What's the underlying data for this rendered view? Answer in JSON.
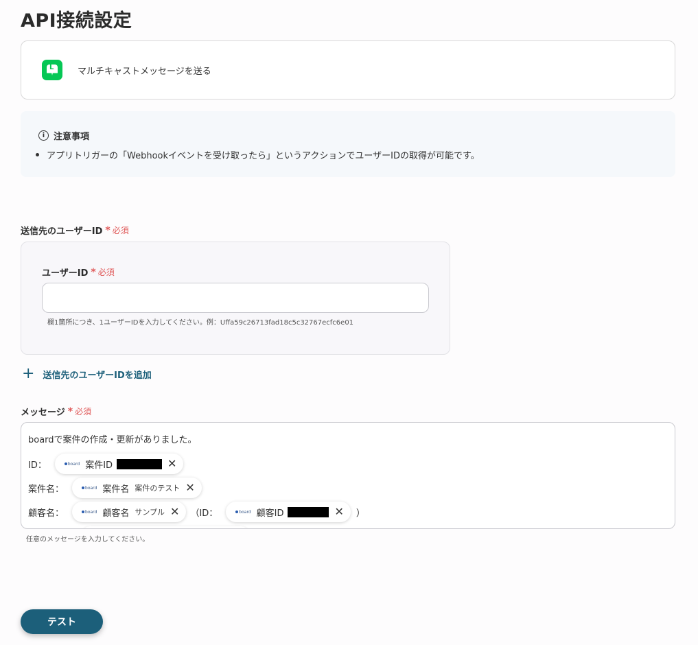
{
  "page": {
    "title": "API接続設定"
  },
  "action": {
    "label": "マルチキャストメッセージを送る",
    "icon": "line-icon",
    "brand_color": "#06c755"
  },
  "notice": {
    "title": "注意事項",
    "items": [
      "アプリトリガーの「Webhookイベントを受け取ったら」というアクションでユーザーIDの取得が可能です。"
    ]
  },
  "recipients": {
    "label": "送信先のユーザーID",
    "required_label": "必須",
    "user_id": {
      "label": "ユーザーID",
      "required_label": "必須",
      "value": "",
      "hint": "欄1箇所につき、1ユーザーIDを入力してください。例：Uffa59c26713fad18c5c32767ecfc6e01"
    },
    "add_label": "送信先のユーザーIDを追加"
  },
  "message": {
    "label": "メッセージ",
    "required_label": "必須",
    "first_line": "boardで案件の作成・更新がありました。",
    "lines": [
      {
        "prefix": "ID：",
        "chip_name": "案件ID",
        "chip_value": ""
      },
      {
        "prefix": "案件名：",
        "chip_name": "案件名",
        "chip_value": "案件のテスト"
      },
      {
        "prefix": "顧客名：",
        "chip_name": "顧客名",
        "chip_value": "サンプル",
        "middle": "（ID：",
        "chip2_name": "顧客ID",
        "suffix": "）"
      }
    ],
    "chip_logo": "board",
    "hint": "任意のメッセージを入力してください。"
  },
  "actions": {
    "test_label": "テスト"
  },
  "colors": {
    "accent": "#1c5f7a",
    "required": "#e05a5a"
  }
}
